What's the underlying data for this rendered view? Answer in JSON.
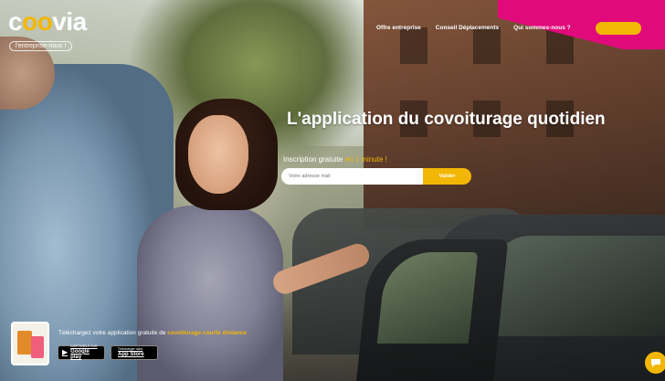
{
  "brand": {
    "logo_part1": "c",
    "logo_o1": "o",
    "logo_o2": "o",
    "logo_part2": "via",
    "tagline": "l'entreprise-nous !"
  },
  "nav": {
    "items": [
      {
        "label": "Offre entreprise"
      },
      {
        "label": "Conseil Déplacements"
      },
      {
        "label": "Qui sommes-nous ?"
      }
    ],
    "cta_label": ""
  },
  "hero": {
    "headline_regular": "L'application du ",
    "headline_bold": "covoiturage quotidien",
    "signup_label": "Inscription gratuite ",
    "signup_highlight": "en 1 minute !",
    "email_placeholder": "Votre adresse mail",
    "signup_button": "Valider"
  },
  "promo": {
    "text": "Téléchargez votre application gratuite de ",
    "highlight": "covoiturage courte distance",
    "google_small": "DISPONIBLE SUR",
    "google_big": "Google play",
    "apple_small": "Télécharger dans",
    "apple_big": "App Store"
  },
  "colors": {
    "accent": "#f2b705",
    "brand_pink": "#e10a7a"
  },
  "icons": {
    "chat": "chat-bubble-icon",
    "google": "google-play-icon",
    "apple": "apple-icon"
  }
}
